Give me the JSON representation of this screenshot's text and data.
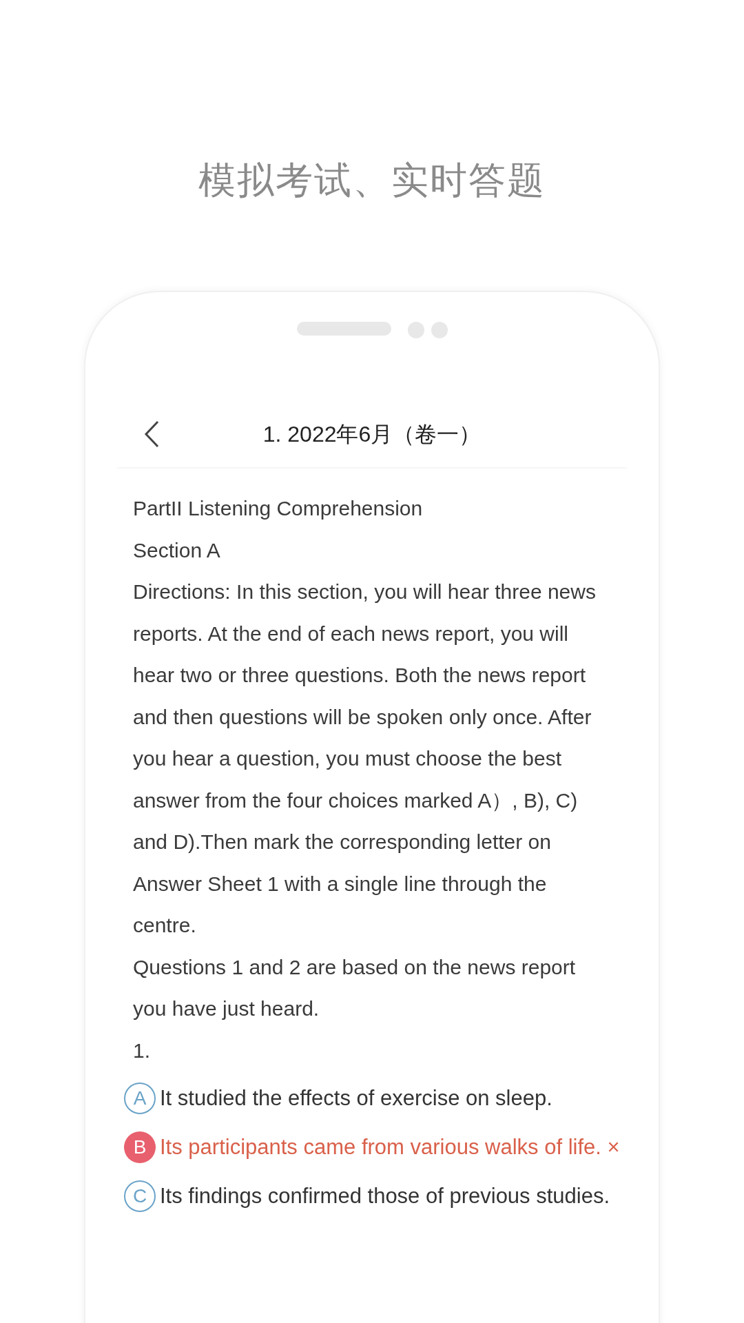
{
  "headline": "模拟考试、实时答题",
  "screen": {
    "title": "1. 2022年6月（卷一）",
    "paragraphs": [
      "PartII Listening Comprehension",
      "Section A",
      "Directions: In this section, you will hear three news reports. At the end of each news report, you will hear two or three questions. Both the news report and then questions will be spoken only once. After you hear a question, you must choose the best answer from the four choices marked A）, B), C) and D).Then mark the corresponding letter on Answer Sheet 1 with a single line through the centre.",
      "Questions 1 and 2 are based on the news report you have just heard.",
      "1."
    ],
    "options": [
      {
        "letter": "A",
        "text": " It studied the effects of exercise on sleep.",
        "kind": "plain"
      },
      {
        "letter": "B",
        "text": " Its participants came from various walks of life. ×",
        "kind": "wrong"
      },
      {
        "letter": "C",
        "text": " Its findings confirmed those of previous studies.",
        "kind": "plain"
      }
    ]
  }
}
